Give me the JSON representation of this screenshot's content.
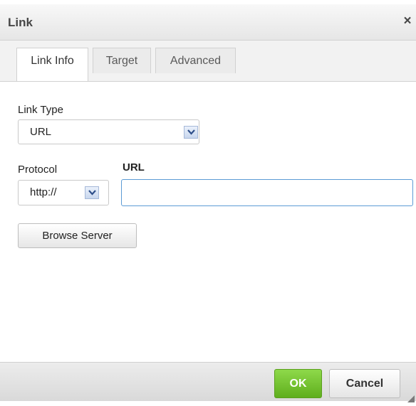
{
  "dialog": {
    "title": "Link",
    "close_glyph": "×",
    "tabs": [
      {
        "label": "Link Info",
        "active": true
      },
      {
        "label": "Target",
        "active": false
      },
      {
        "label": "Advanced",
        "active": false
      }
    ],
    "link_type": {
      "label": "Link Type",
      "selected": "URL"
    },
    "protocol": {
      "label": "Protocol",
      "selected": "http://"
    },
    "url": {
      "label": "URL",
      "value": ""
    },
    "browse_button": "Browse Server",
    "ok_button": "OK",
    "cancel_button": "Cancel"
  },
  "icons": {
    "close": "close-icon",
    "dropdown": "chevron-down-icon",
    "resize": "resize-handle-icon"
  },
  "colors": {
    "ok_green": "#6cbf2a",
    "focus_blue": "#5b9bd5",
    "titlebar": "#efefef"
  }
}
